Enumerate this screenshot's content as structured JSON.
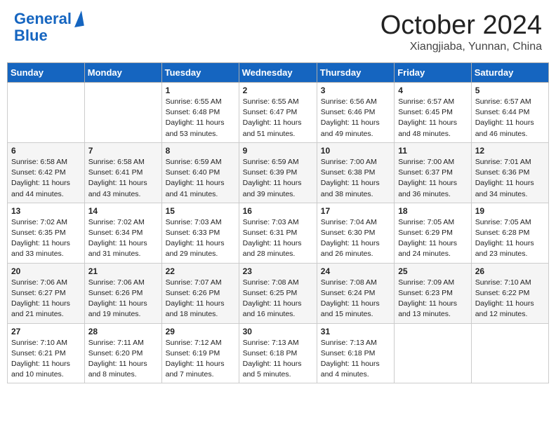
{
  "header": {
    "logo": {
      "line1": "General",
      "line2": "Blue"
    },
    "title": "October 2024",
    "subtitle": "Xiangjiaba, Yunnan, China"
  },
  "days_of_week": [
    "Sunday",
    "Monday",
    "Tuesday",
    "Wednesday",
    "Thursday",
    "Friday",
    "Saturday"
  ],
  "weeks": [
    [
      {
        "day": "",
        "info": ""
      },
      {
        "day": "",
        "info": ""
      },
      {
        "day": "1",
        "info": "Sunrise: 6:55 AM\nSunset: 6:48 PM\nDaylight: 11 hours and 53 minutes."
      },
      {
        "day": "2",
        "info": "Sunrise: 6:55 AM\nSunset: 6:47 PM\nDaylight: 11 hours and 51 minutes."
      },
      {
        "day": "3",
        "info": "Sunrise: 6:56 AM\nSunset: 6:46 PM\nDaylight: 11 hours and 49 minutes."
      },
      {
        "day": "4",
        "info": "Sunrise: 6:57 AM\nSunset: 6:45 PM\nDaylight: 11 hours and 48 minutes."
      },
      {
        "day": "5",
        "info": "Sunrise: 6:57 AM\nSunset: 6:44 PM\nDaylight: 11 hours and 46 minutes."
      }
    ],
    [
      {
        "day": "6",
        "info": "Sunrise: 6:58 AM\nSunset: 6:42 PM\nDaylight: 11 hours and 44 minutes."
      },
      {
        "day": "7",
        "info": "Sunrise: 6:58 AM\nSunset: 6:41 PM\nDaylight: 11 hours and 43 minutes."
      },
      {
        "day": "8",
        "info": "Sunrise: 6:59 AM\nSunset: 6:40 PM\nDaylight: 11 hours and 41 minutes."
      },
      {
        "day": "9",
        "info": "Sunrise: 6:59 AM\nSunset: 6:39 PM\nDaylight: 11 hours and 39 minutes."
      },
      {
        "day": "10",
        "info": "Sunrise: 7:00 AM\nSunset: 6:38 PM\nDaylight: 11 hours and 38 minutes."
      },
      {
        "day": "11",
        "info": "Sunrise: 7:00 AM\nSunset: 6:37 PM\nDaylight: 11 hours and 36 minutes."
      },
      {
        "day": "12",
        "info": "Sunrise: 7:01 AM\nSunset: 6:36 PM\nDaylight: 11 hours and 34 minutes."
      }
    ],
    [
      {
        "day": "13",
        "info": "Sunrise: 7:02 AM\nSunset: 6:35 PM\nDaylight: 11 hours and 33 minutes."
      },
      {
        "day": "14",
        "info": "Sunrise: 7:02 AM\nSunset: 6:34 PM\nDaylight: 11 hours and 31 minutes."
      },
      {
        "day": "15",
        "info": "Sunrise: 7:03 AM\nSunset: 6:33 PM\nDaylight: 11 hours and 29 minutes."
      },
      {
        "day": "16",
        "info": "Sunrise: 7:03 AM\nSunset: 6:31 PM\nDaylight: 11 hours and 28 minutes."
      },
      {
        "day": "17",
        "info": "Sunrise: 7:04 AM\nSunset: 6:30 PM\nDaylight: 11 hours and 26 minutes."
      },
      {
        "day": "18",
        "info": "Sunrise: 7:05 AM\nSunset: 6:29 PM\nDaylight: 11 hours and 24 minutes."
      },
      {
        "day": "19",
        "info": "Sunrise: 7:05 AM\nSunset: 6:28 PM\nDaylight: 11 hours and 23 minutes."
      }
    ],
    [
      {
        "day": "20",
        "info": "Sunrise: 7:06 AM\nSunset: 6:27 PM\nDaylight: 11 hours and 21 minutes."
      },
      {
        "day": "21",
        "info": "Sunrise: 7:06 AM\nSunset: 6:26 PM\nDaylight: 11 hours and 19 minutes."
      },
      {
        "day": "22",
        "info": "Sunrise: 7:07 AM\nSunset: 6:26 PM\nDaylight: 11 hours and 18 minutes."
      },
      {
        "day": "23",
        "info": "Sunrise: 7:08 AM\nSunset: 6:25 PM\nDaylight: 11 hours and 16 minutes."
      },
      {
        "day": "24",
        "info": "Sunrise: 7:08 AM\nSunset: 6:24 PM\nDaylight: 11 hours and 15 minutes."
      },
      {
        "day": "25",
        "info": "Sunrise: 7:09 AM\nSunset: 6:23 PM\nDaylight: 11 hours and 13 minutes."
      },
      {
        "day": "26",
        "info": "Sunrise: 7:10 AM\nSunset: 6:22 PM\nDaylight: 11 hours and 12 minutes."
      }
    ],
    [
      {
        "day": "27",
        "info": "Sunrise: 7:10 AM\nSunset: 6:21 PM\nDaylight: 11 hours and 10 minutes."
      },
      {
        "day": "28",
        "info": "Sunrise: 7:11 AM\nSunset: 6:20 PM\nDaylight: 11 hours and 8 minutes."
      },
      {
        "day": "29",
        "info": "Sunrise: 7:12 AM\nSunset: 6:19 PM\nDaylight: 11 hours and 7 minutes."
      },
      {
        "day": "30",
        "info": "Sunrise: 7:13 AM\nSunset: 6:18 PM\nDaylight: 11 hours and 5 minutes."
      },
      {
        "day": "31",
        "info": "Sunrise: 7:13 AM\nSunset: 6:18 PM\nDaylight: 11 hours and 4 minutes."
      },
      {
        "day": "",
        "info": ""
      },
      {
        "day": "",
        "info": ""
      }
    ]
  ]
}
